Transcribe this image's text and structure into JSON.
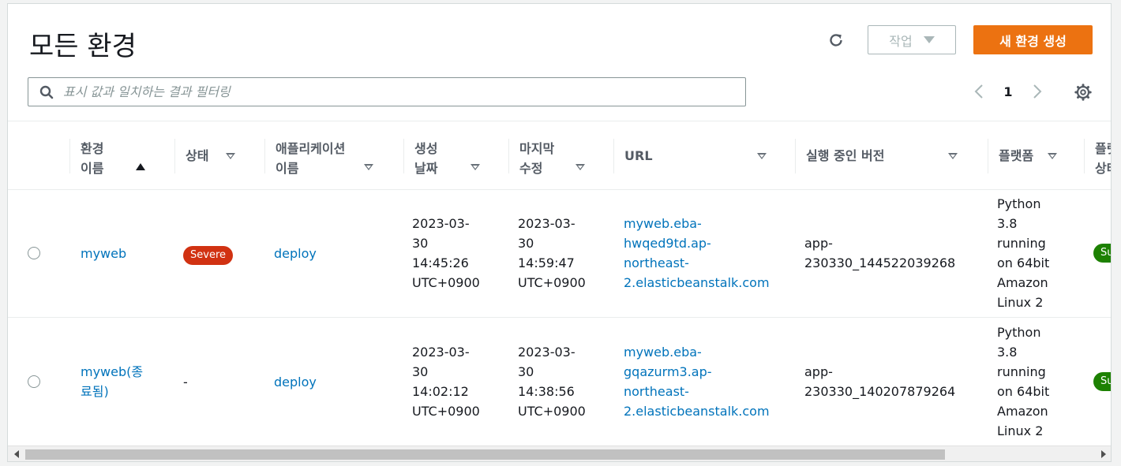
{
  "header": {
    "title": "모든 환경",
    "actions_label": "작업",
    "create_label": "새 환경 생성"
  },
  "search": {
    "placeholder": "표시 값과 일치하는 결과 필터링",
    "value": ""
  },
  "pagination": {
    "current_page": "1"
  },
  "table": {
    "columns": {
      "env_name_1": "환경",
      "env_name_2": "이름",
      "status": "상태",
      "app_name_1": "애플리케이션",
      "app_name_2": "이름",
      "created_1": "생성",
      "created_2": "날짜",
      "modified_1": "마지막",
      "modified_2": "수정",
      "url": "URL",
      "running_version": "실행 중인 버전",
      "platform": "플랫폼",
      "platform_status_1": "플랫",
      "platform_status_2": "상태"
    },
    "rows": [
      {
        "env_name_1": "myweb",
        "env_name_2": "",
        "health": "Severe",
        "app_name": "deploy",
        "created": [
          "2023-03-",
          "30",
          "14:45:26",
          "UTC+0900"
        ],
        "modified": [
          "2023-03-",
          "30",
          "14:59:47",
          "UTC+0900"
        ],
        "url": [
          "myweb.eba-",
          "hwqed9td.ap-",
          "northeast-",
          "2.elasticbeanstalk.com"
        ],
        "version": [
          "app-",
          "230330_144522039268"
        ],
        "platform": [
          "Python",
          "3.8",
          "running",
          "on 64bit",
          "Amazon",
          "Linux 2"
        ],
        "platform_status": "Supported"
      },
      {
        "env_name_1": "myweb(종",
        "env_name_2": "료됨)",
        "health": "-",
        "app_name": "deploy",
        "created": [
          "2023-03-",
          "30",
          "14:02:12",
          "UTC+0900"
        ],
        "modified": [
          "2023-03-",
          "30",
          "14:38:56",
          "UTC+0900"
        ],
        "url": [
          "myweb.eba-",
          "gqazurm3.ap-",
          "northeast-",
          "2.elasticbeanstalk.com"
        ],
        "version": [
          "app-",
          "230330_140207879264"
        ],
        "platform": [
          "Python",
          "3.8",
          "running",
          "on 64bit",
          "Amazon",
          "Linux 2"
        ],
        "platform_status": "Supported"
      }
    ]
  },
  "colors": {
    "accent": "#ec7211",
    "link": "#0073bb",
    "severe": "#d13212",
    "supported": "#1d8102"
  }
}
